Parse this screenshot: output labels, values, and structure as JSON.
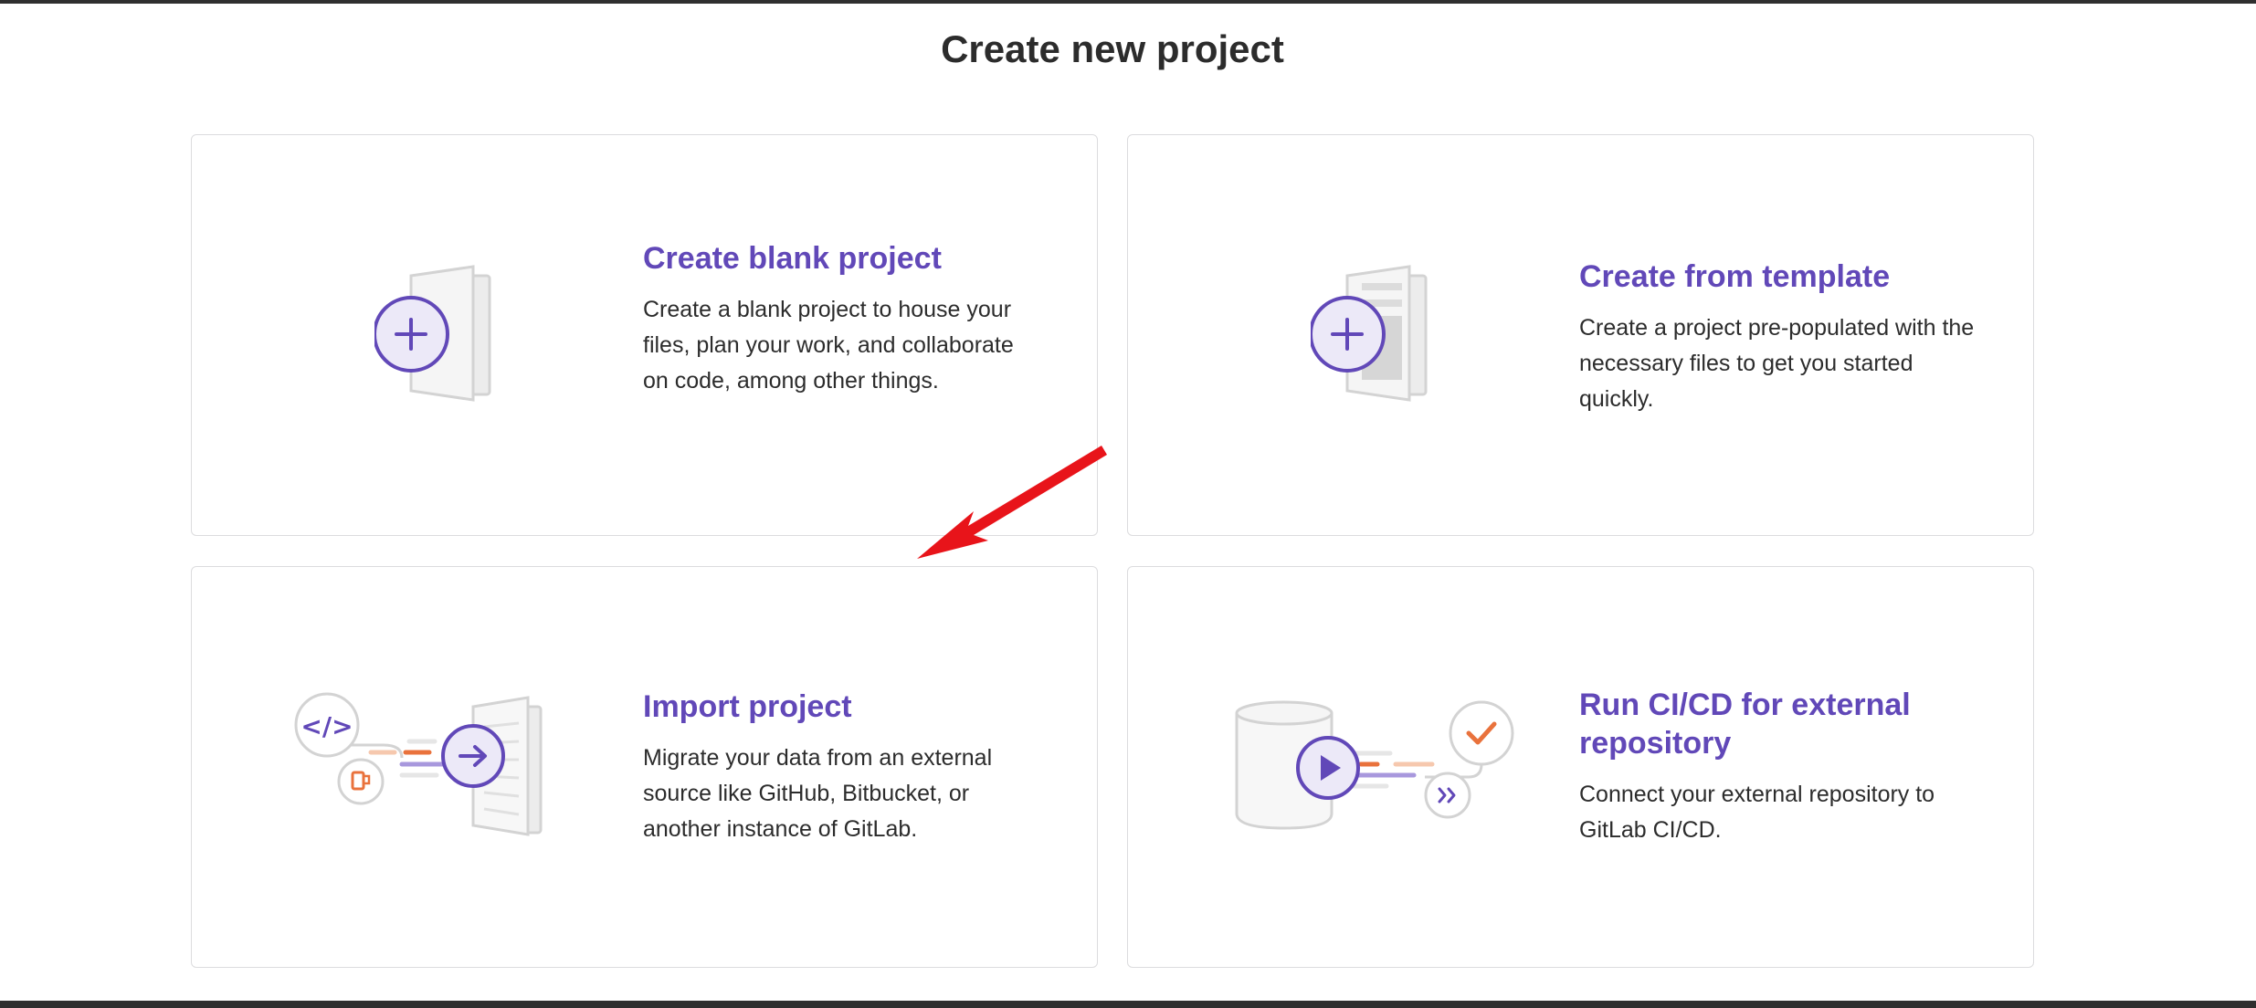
{
  "page": {
    "title": "Create new project"
  },
  "cards": [
    {
      "id": "blank",
      "title": "Create blank project",
      "description": "Create a blank project to house your files, plan your work, and collaborate on code, among other things.",
      "icon": "blank-project-illustration"
    },
    {
      "id": "template",
      "title": "Create from template",
      "description": "Create a project pre-populated with the necessary files to get you started quickly.",
      "icon": "template-project-illustration"
    },
    {
      "id": "import",
      "title": "Import project",
      "description": "Migrate your data from an external source like GitHub, Bitbucket, or another instance of GitLab.",
      "icon": "import-project-illustration"
    },
    {
      "id": "cicd",
      "title": "Run CI/CD for external repository",
      "description": "Connect your external repository to GitLab CI/CD.",
      "icon": "cicd-external-repo-illustration"
    }
  ],
  "annotation": {
    "type": "red-arrow",
    "points_to": "Import project card",
    "color": "#e8141a"
  },
  "colors": {
    "accent": "#6148b8",
    "orange": "#e9723c",
    "border": "#dcdcde"
  }
}
